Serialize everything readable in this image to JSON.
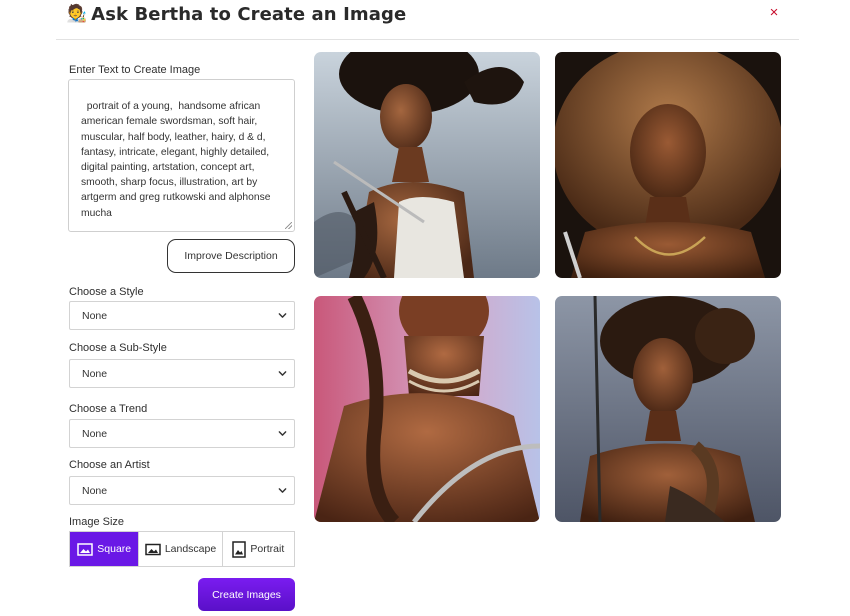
{
  "header": {
    "emoji": "🧑‍🎨",
    "title": "Ask Bertha to Create an Image",
    "close_glyph": "×"
  },
  "form": {
    "prompt_label": "Enter Text to Create Image",
    "prompt_text": "portrait of a young,  handsome african american female swordsman, soft hair, muscular, half body, leather, hairy, d & d, fantasy, intricate, elegant, highly detailed, digital painting, artstation, concept art, smooth, sharp focus, illustration, art by artgerm and greg rutkowski and alphonse mucha",
    "improve_label": "Improve Description",
    "style": {
      "label": "Choose a Style",
      "value": "None"
    },
    "substyle": {
      "label": "Choose a Sub-Style",
      "value": "None"
    },
    "trend": {
      "label": "Choose a Trend",
      "value": "None"
    },
    "artist": {
      "label": "Choose an Artist",
      "value": "None"
    },
    "image_size": {
      "label": "Image Size",
      "options": [
        "Square",
        "Landscape",
        "Portrait"
      ],
      "selected": "Square"
    },
    "create_label": "Create Images"
  },
  "colors": {
    "accent": "#6a18e6",
    "close": "#c8102e"
  },
  "gallery": {
    "images": [
      {
        "description": "fantasy portrait, woman with large natural afro, white top, sword hilt"
      },
      {
        "description": "portrait of woman with voluminous brown curly hair, gold chain and bow"
      },
      {
        "description": "close-up of neck with braided hair, wrapped cord choker, blade"
      },
      {
        "description": "woman with braided updo holding sword, rope wrapped shoulder"
      }
    ]
  }
}
